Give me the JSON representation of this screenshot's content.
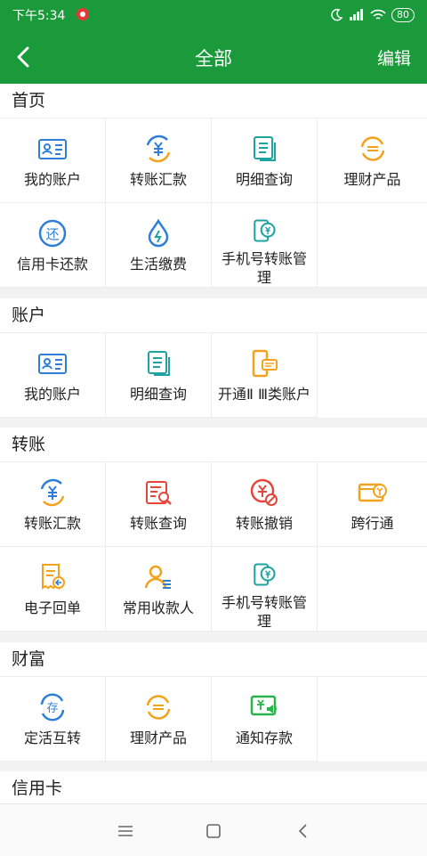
{
  "status_bar": {
    "time": "下午5:34",
    "battery": "80"
  },
  "header": {
    "title": "全部",
    "edit_label": "编辑"
  },
  "sections": [
    {
      "title": "首页",
      "items": [
        {
          "label": "我的账户",
          "icon": "account-card-icon"
        },
        {
          "label": "转账汇款",
          "icon": "transfer-yuan-icon"
        },
        {
          "label": "明细查询",
          "icon": "statement-icon"
        },
        {
          "label": "理财产品",
          "icon": "wealth-product-icon"
        },
        {
          "label": "信用卡还款",
          "icon": "repay-icon"
        },
        {
          "label": "生活缴费",
          "icon": "water-drop-icon"
        },
        {
          "label": "手机号转账管理",
          "icon": "phone-transfer-icon"
        }
      ]
    },
    {
      "title": "账户",
      "items": [
        {
          "label": "我的账户",
          "icon": "account-card-icon"
        },
        {
          "label": "明细查询",
          "icon": "statement-icon"
        },
        {
          "label": "开通Ⅱ Ⅲ类账户",
          "icon": "open-account-icon"
        }
      ]
    },
    {
      "title": "转账",
      "items": [
        {
          "label": "转账汇款",
          "icon": "transfer-yuan-icon"
        },
        {
          "label": "转账查询",
          "icon": "transfer-query-icon"
        },
        {
          "label": "转账撤销",
          "icon": "transfer-cancel-icon"
        },
        {
          "label": "跨行通",
          "icon": "interbank-icon"
        },
        {
          "label": "电子回单",
          "icon": "e-receipt-icon"
        },
        {
          "label": "常用收款人",
          "icon": "payee-icon"
        },
        {
          "label": "手机号转账管理",
          "icon": "phone-transfer-icon"
        }
      ]
    },
    {
      "title": "财富",
      "items": [
        {
          "label": "定活互转",
          "icon": "deposit-switch-icon"
        },
        {
          "label": "理财产品",
          "icon": "wealth-product-icon"
        },
        {
          "label": "通知存款",
          "icon": "notice-deposit-icon"
        }
      ]
    },
    {
      "title": "信用卡",
      "items": []
    }
  ],
  "colors": {
    "brand_green": "#1a9a3a",
    "icon_blue": "#2f7fd8",
    "icon_teal": "#1fa3a0",
    "icon_orange": "#f3a21b",
    "icon_red": "#e5463c",
    "icon_green": "#2bb24c"
  }
}
